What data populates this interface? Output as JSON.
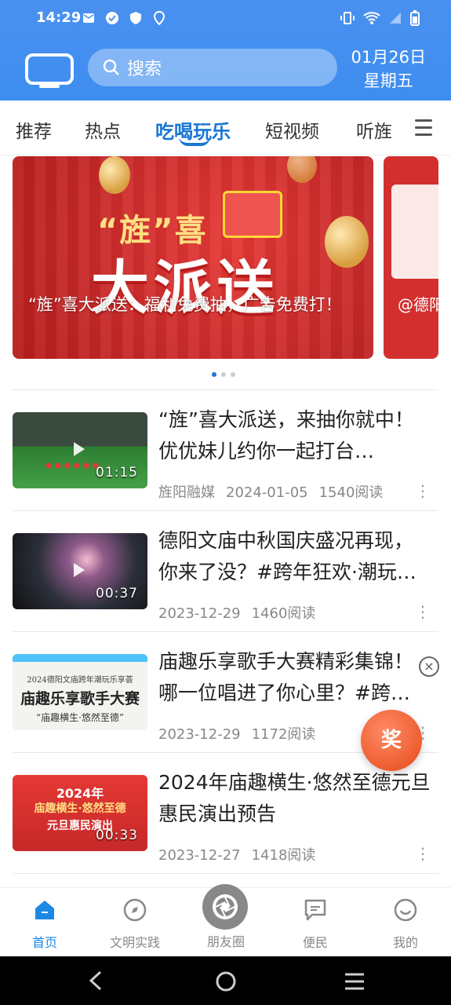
{
  "status": {
    "time": "14:29"
  },
  "header": {
    "search_placeholder": "搜索",
    "date": "01月26日",
    "weekday": "星期五"
  },
  "tabs": [
    {
      "label": "推荐"
    },
    {
      "label": "热点"
    },
    {
      "label": "吃喝玩乐",
      "active": true
    },
    {
      "label": "短视频"
    },
    {
      "label": "听旌"
    }
  ],
  "banner": {
    "title_small": "“旌”喜",
    "title_big": "大派送",
    "caption": "“旌”喜大派送：福利免费抽，广告免费打！",
    "next_caption": "@德阳 费送"
  },
  "articles": [
    {
      "title": "“旌”喜大派送，来抽你就中！优优妹儿约你一起打台…",
      "source": "旌阳融媒",
      "date": "2024-01-05",
      "reads": "1540阅读",
      "duration": "01:15"
    },
    {
      "title": "德阳文庙中秋国庆盛况再现，你来了没？#跨年狂欢·潮玩…",
      "source": "",
      "date": "2023-12-29",
      "reads": "1460阅读",
      "duration": "00:37"
    },
    {
      "title": "庙趣乐享歌手大赛精彩集锦！哪一位唱进了你心里？#跨…",
      "source": "",
      "date": "2023-12-29",
      "reads": "1172阅读",
      "duration": "",
      "thumb_text1": "2024德阳文庙跨年潮玩乐享荟",
      "thumb_text2": "庙趣乐享歌手大赛",
      "thumb_text3": "“庙趣横生·悠然至德”"
    },
    {
      "title": "2024年庙趣横生·悠然至德元旦惠民演出预告",
      "source": "",
      "date": "2023-12-27",
      "reads": "1418阅读",
      "duration": "00:33",
      "thumb_text1": "2024年",
      "thumb_text2": "庙趣横生·悠然至德",
      "thumb_text3": "元旦惠民演出"
    }
  ],
  "float": {
    "prize_label": "奖",
    "close": "×"
  },
  "bottom_nav": [
    {
      "label": "首页",
      "icon": "home-icon",
      "active": true
    },
    {
      "label": "文明实践",
      "icon": "compass-icon"
    },
    {
      "label": "朋友圈",
      "icon": "camera-shutter-icon"
    },
    {
      "label": "便民",
      "icon": "chat-bubble-icon"
    },
    {
      "label": "我的",
      "icon": "smile-icon"
    }
  ],
  "colors": {
    "accent": "#1976d2",
    "header_bg": "#4a90f0",
    "banner_red": "#d32f2f"
  }
}
